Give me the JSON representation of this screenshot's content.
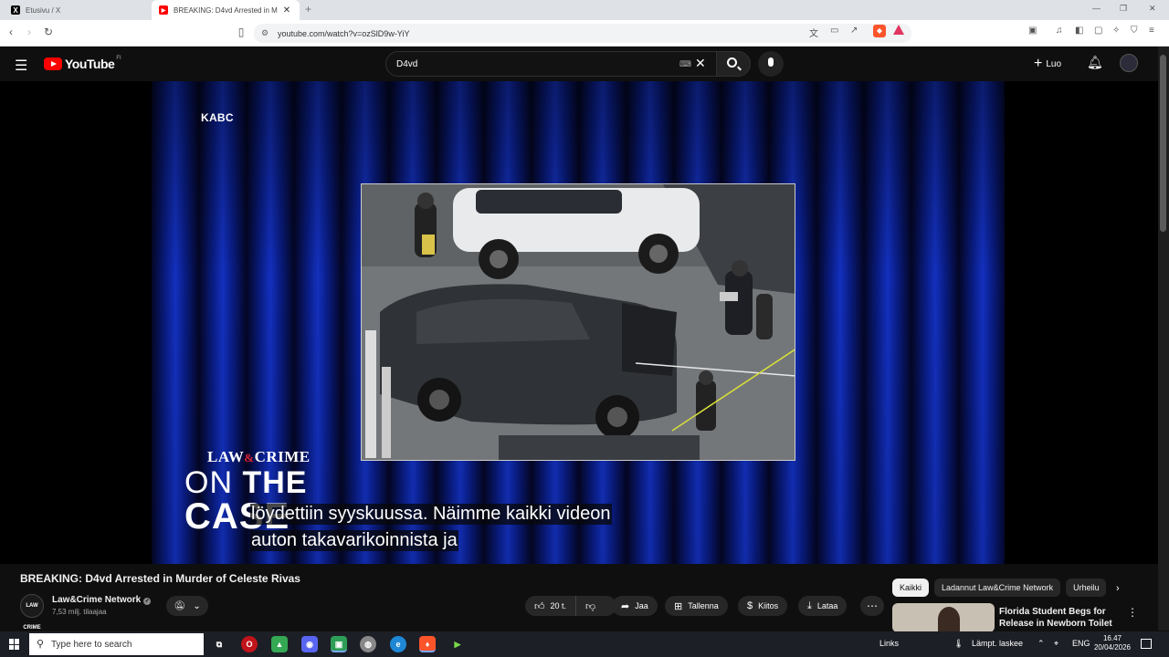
{
  "browser": {
    "tabs": [
      {
        "label": "Etusivu / X",
        "favicon": "x-logo-icon",
        "active": false
      },
      {
        "label": "BREAKING: D4vd Arrested in M",
        "favicon": "youtube-icon",
        "active": true
      }
    ],
    "url": "youtube.com/watch?v=ozSlD9w-YiY"
  },
  "youtube": {
    "logo_text": "YouTube",
    "country_code": "FI",
    "search_value": "D4vd",
    "create_label": "Luo"
  },
  "video": {
    "station_bug": "KABC",
    "brand_logo": {
      "line1": "LAW&CRIME",
      "line2a": "ON",
      "line2b": "THE",
      "line3": "CASE"
    },
    "captions": [
      "löydettiin syyskuussa.  Näimme kaikki videon",
      "auton takavarikoinnista ja"
    ]
  },
  "watch": {
    "title": "BREAKING: D4vd Arrested in Murder of Celeste Rivas",
    "channel_name": "Law&Crime Network",
    "channel_avatar_text": "LAW CRIME",
    "subscribers": "7,53 milj. tilaajaa",
    "like_count": "20 t.",
    "share_label": "Jaa",
    "save_label": "Tallenna",
    "thanks_label": "Kiitos",
    "download_label": "Lataa"
  },
  "sidebar": {
    "chips": [
      {
        "label": "Kaikki",
        "active": true
      },
      {
        "label": "Ladannut Law&Crime Network",
        "active": false
      },
      {
        "label": "Urheilu",
        "active": false
      }
    ],
    "recommendation": {
      "title": "Florida Student Begs for Release in Newborn Toilet ..."
    }
  },
  "taskbar": {
    "search_placeholder": "Type here to search",
    "links_label": "Links",
    "weather_text": "Lämpt. laskee",
    "language": "ENG",
    "time": "16.47",
    "date": "20/04/2026"
  },
  "colors": {
    "youtube_red": "#ff0000",
    "page_bg": "#0f0f0f",
    "curtain_blue": "#1533c8"
  }
}
